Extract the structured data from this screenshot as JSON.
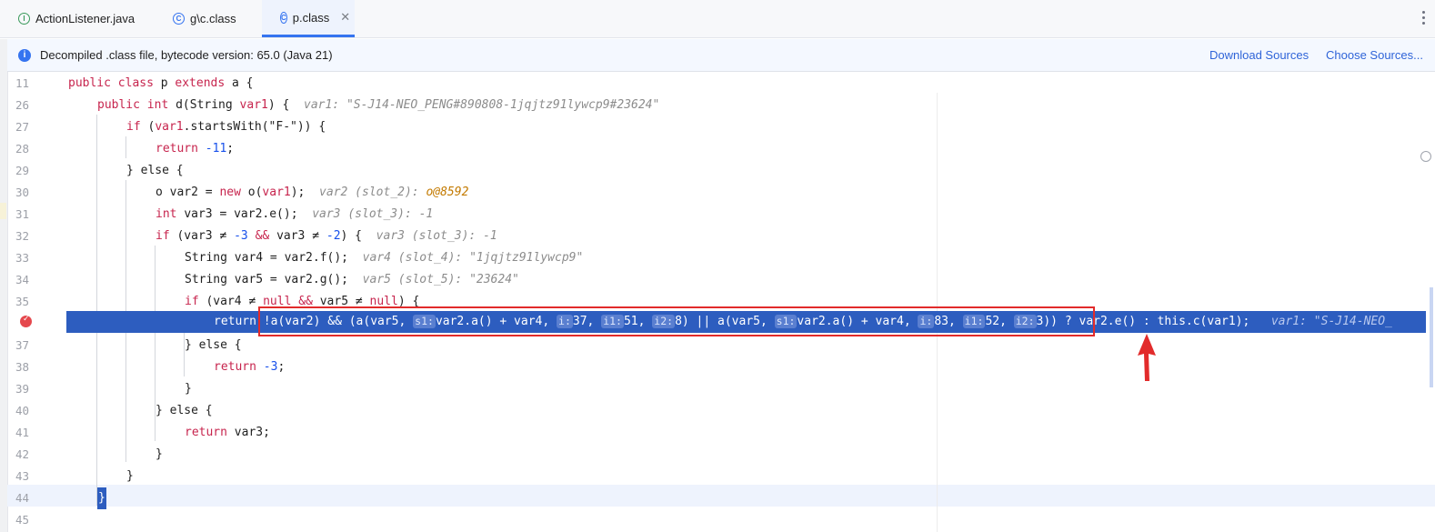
{
  "tabs": [
    {
      "label": "ActionListener.java",
      "icon": "interface-icon",
      "active": false
    },
    {
      "label": "g\\c.class",
      "icon": "class-icon",
      "active": false
    },
    {
      "label": "p.class",
      "icon": "class-icon",
      "active": true
    }
  ],
  "banner": {
    "text": "Decompiled .class file, bytecode version: 65.0 (Java 21)",
    "download_sources": "Download Sources",
    "choose_sources": "Choose Sources..."
  },
  "editor": {
    "lines": [
      {
        "n": "11"
      },
      {
        "n": "26"
      },
      {
        "n": "27"
      },
      {
        "n": "28"
      },
      {
        "n": "29"
      },
      {
        "n": "30"
      },
      {
        "n": "31"
      },
      {
        "n": "32"
      },
      {
        "n": "33"
      },
      {
        "n": "34"
      },
      {
        "n": "35"
      },
      {
        "n": "36"
      },
      {
        "n": "37"
      },
      {
        "n": "38"
      },
      {
        "n": "39"
      },
      {
        "n": "40"
      },
      {
        "n": "41"
      },
      {
        "n": "42"
      },
      {
        "n": "43"
      },
      {
        "n": "44"
      },
      {
        "n": "45"
      }
    ],
    "code": {
      "l11_a": "public class ",
      "l11_b": "p ",
      "l11_c": "extends ",
      "l11_d": "a {",
      "l26_a": "public int ",
      "l26_b": "d(String ",
      "l26_c": "var1",
      "l26_d": ") {",
      "l26_hint": "var1: \"S-J14-NEO_PENG#890808-1jqjtz91lywcp9#23624\"",
      "l27_a": "if ",
      "l27_b": "(",
      "l27_c": "var1",
      "l27_d": ".startsWith(\"F-\")) {",
      "l28_a": "return ",
      "l28_b": "-11",
      "l28_c": ";",
      "l29": "} else {",
      "l30_a": "o var2 = ",
      "l30_b": "new ",
      "l30_c": "o(",
      "l30_d": "var1",
      "l30_e": ");",
      "l30_hint": "var2 (slot_2): ",
      "l30_hintval": "o@8592",
      "l31_a": "int ",
      "l31_b": "var3 = var2.e();",
      "l31_hint": "var3 (slot_3): -1",
      "l32_a": "if ",
      "l32_b": "(var3 ≠ ",
      "l32_c": "-3 ",
      "l32_d": "&& ",
      "l32_e": "var3 ≠ ",
      "l32_f": "-2",
      "l32_g": ") {",
      "l32_hint": "var3 (slot_3): -1",
      "l33": "String var4 = var2.f();",
      "l33_hint": "var4 (slot_4): \"1jqjtz91lywcp9\"",
      "l34": "String var5 = var2.g();",
      "l34_hint": "var5 (slot_5): \"23624\"",
      "l35_a": "if ",
      "l35_b": "(var4 ≠ ",
      "l35_c": "null ",
      "l35_d": "&& ",
      "l35_e": "var5 ≠ ",
      "l35_f": "null",
      "l35_g": ") {",
      "l36_a": "return ",
      "l36_b": "!a(var2) && (a(var5, ",
      "l36_p1": "s1:",
      "l36_c": "var2.a() + var4, ",
      "l36_p2": "i:",
      "l36_d": "37, ",
      "l36_p3": "i1:",
      "l36_e": "51, ",
      "l36_p4": "i2:",
      "l36_f": "8) || a(var5, ",
      "l36_p5": "s1:",
      "l36_g": "var2.a() + var4, ",
      "l36_p6": "i:",
      "l36_h": "83, ",
      "l36_p7": "i1:",
      "l36_i": "52, ",
      "l36_p8": "i2:",
      "l36_j": "3)) ? var2.e() : this.c(var1);",
      "l36_hint": "var1: \"S-J14-NEO_",
      "l37": "} else {",
      "l38_a": "return ",
      "l38_b": "-3",
      "l38_c": ";",
      "l39": "}",
      "l40": "} else {",
      "l41_a": "return ",
      "l41_b": "var3;",
      "l42": "}",
      "l43": "}",
      "l44": "}"
    }
  }
}
